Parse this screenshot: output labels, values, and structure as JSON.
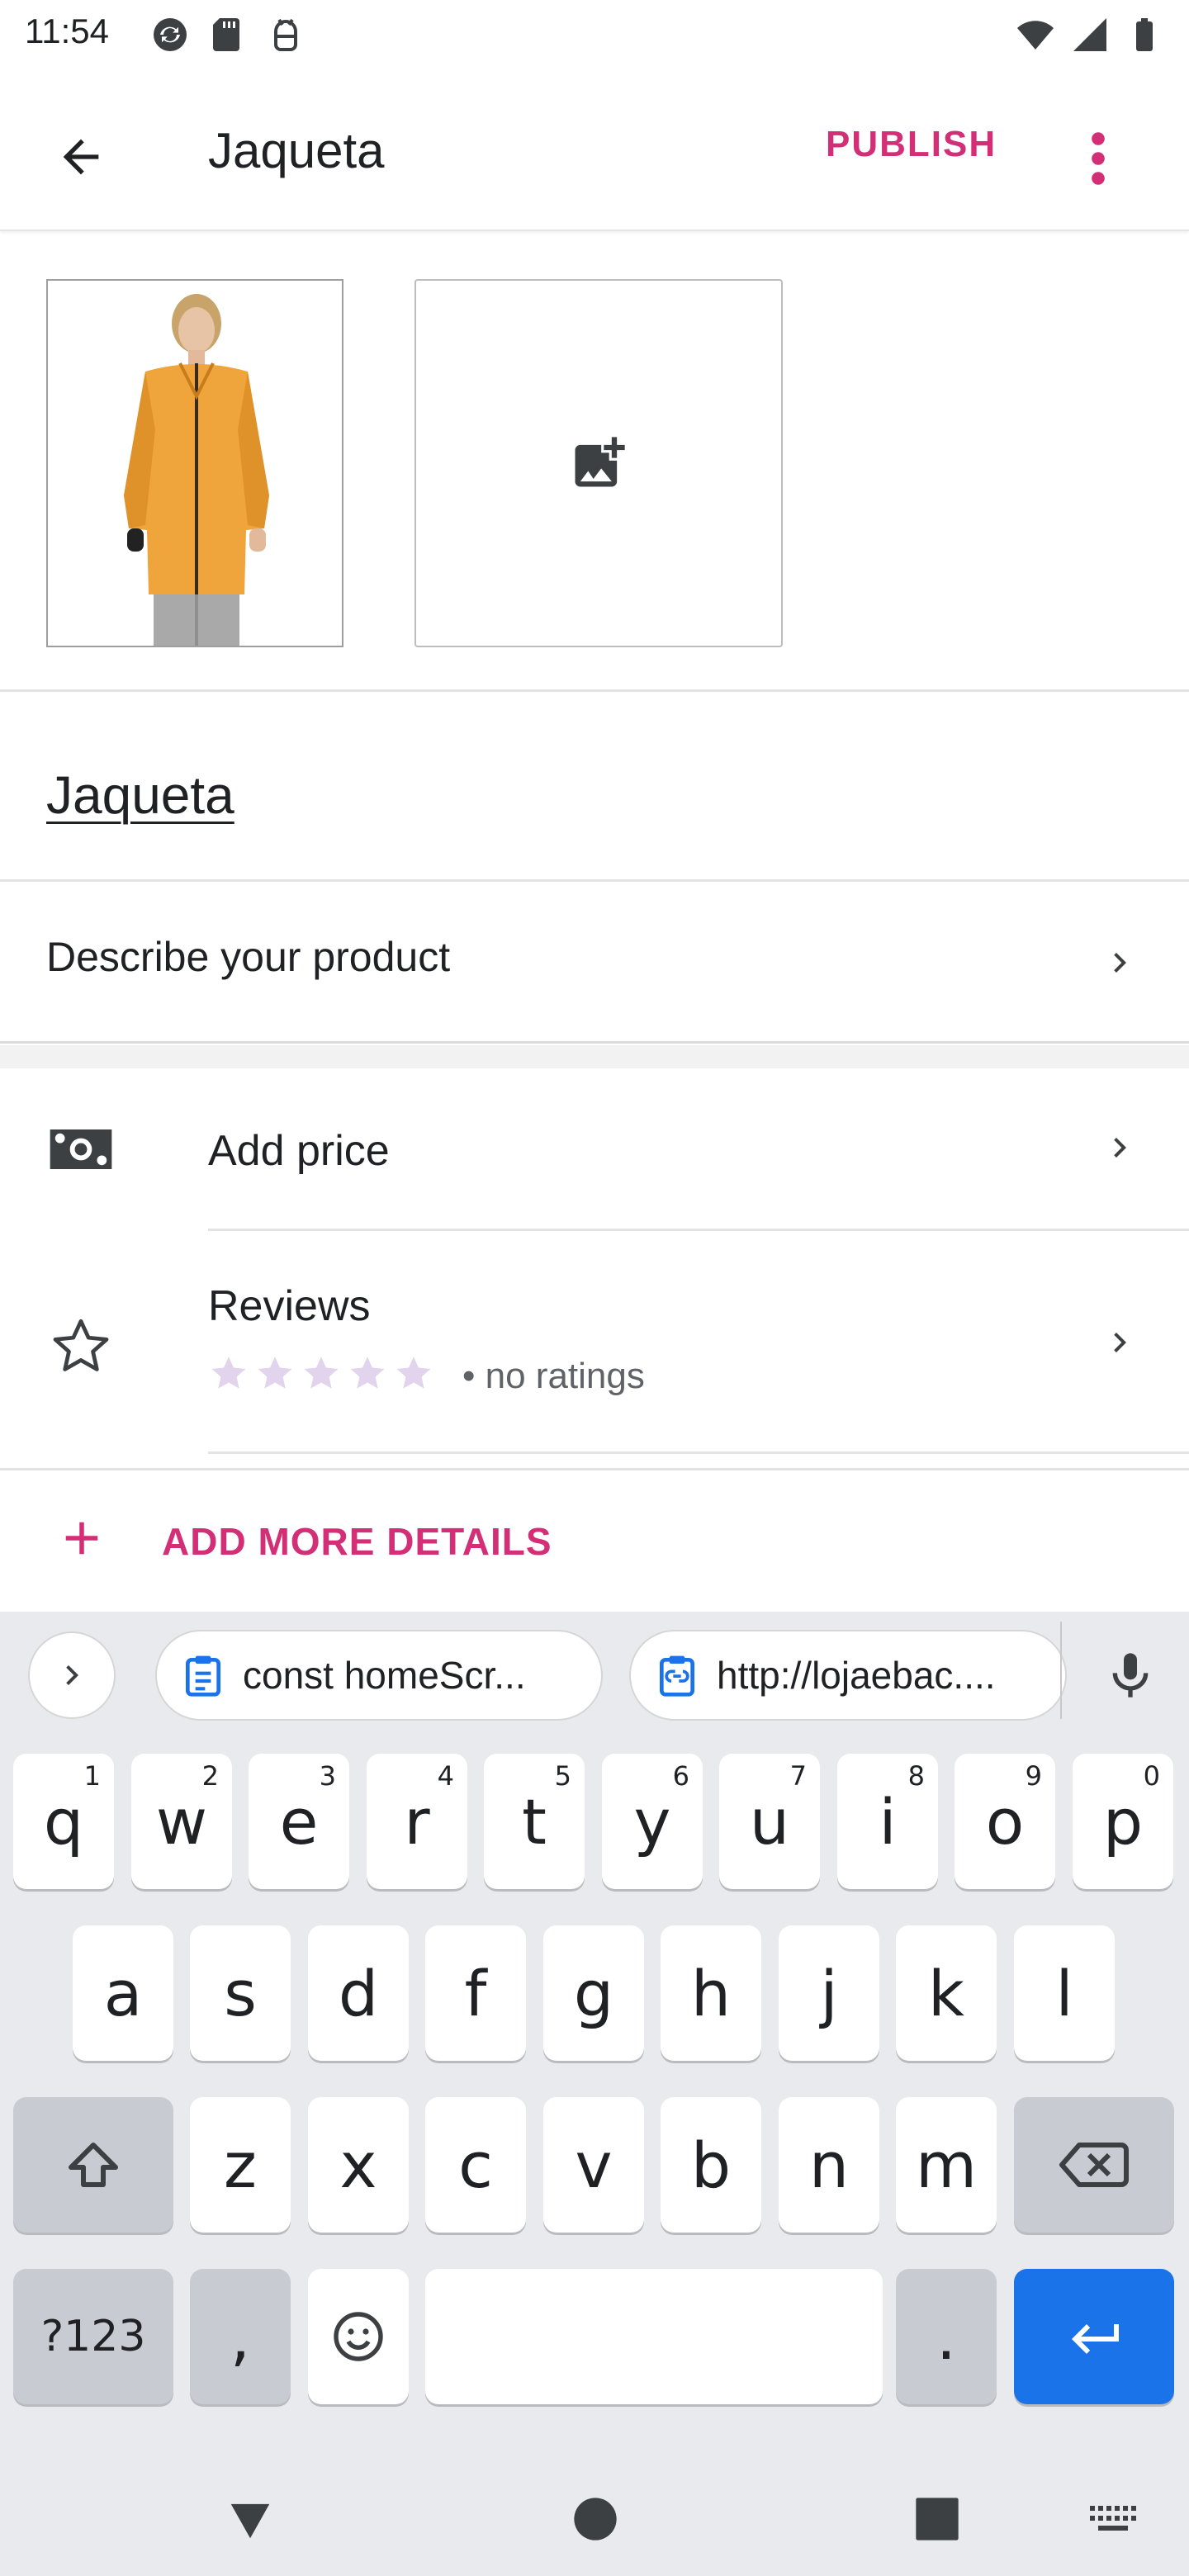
{
  "status_bar": {
    "time": "11:54",
    "left_icons": [
      "sync-icon",
      "sd-card-icon",
      "android-debug-icon"
    ],
    "right_icons": [
      "wifi-icon",
      "signal-icon",
      "battery-icon"
    ]
  },
  "app_bar": {
    "title": "Jaqueta",
    "publish_label": "PUBLISH",
    "accent_color": "#d32f76"
  },
  "images": {
    "product_image_alt": "Jaqueta",
    "add_image_icon": "add-photo-icon"
  },
  "product": {
    "title": "Jaqueta",
    "describe_label": "Describe your product"
  },
  "details": {
    "price_label": "Add price",
    "reviews_label": "Reviews",
    "reviews_rating": 0,
    "reviews_max": 5,
    "reviews_meta": "• no ratings",
    "add_more_label": "ADD MORE DETAILS"
  },
  "keyboard": {
    "suggestions": [
      "const homeScr...",
      "http://lojaebac...."
    ],
    "row1": [
      {
        "key": "q",
        "hint": "1"
      },
      {
        "key": "w",
        "hint": "2"
      },
      {
        "key": "e",
        "hint": "3"
      },
      {
        "key": "r",
        "hint": "4"
      },
      {
        "key": "t",
        "hint": "5"
      },
      {
        "key": "y",
        "hint": "6"
      },
      {
        "key": "u",
        "hint": "7"
      },
      {
        "key": "i",
        "hint": "8"
      },
      {
        "key": "o",
        "hint": "9"
      },
      {
        "key": "p",
        "hint": "0"
      }
    ],
    "row2": [
      "a",
      "s",
      "d",
      "f",
      "g",
      "h",
      "j",
      "k",
      "l"
    ],
    "row3": [
      "z",
      "x",
      "c",
      "v",
      "b",
      "n",
      "m"
    ],
    "symbols_label": "?123",
    "comma_label": ",",
    "period_label": ".",
    "enter_color": "#1a73e8"
  }
}
